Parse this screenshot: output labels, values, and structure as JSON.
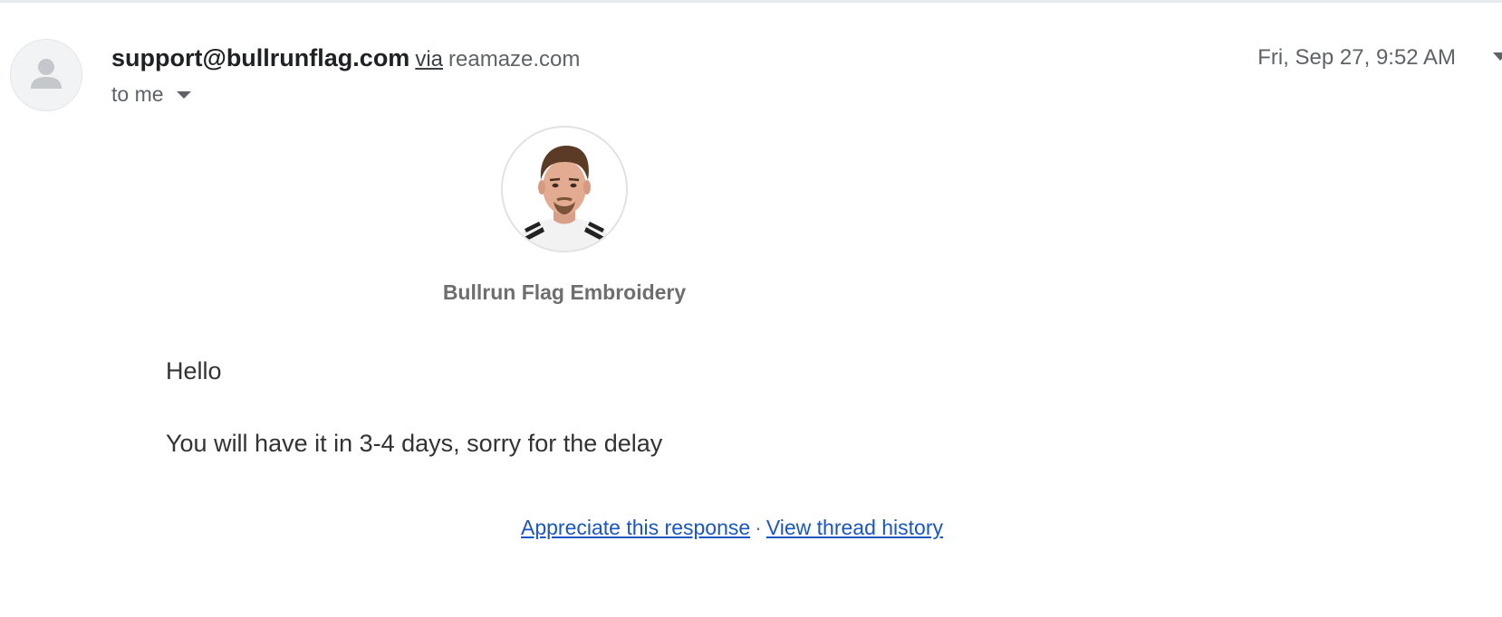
{
  "header": {
    "sender_email": "support@bullrunflag.com",
    "via_label": "via",
    "via_domain": "reamaze.com",
    "recipient_label": "to me",
    "date": "Fri, Sep 27, 9:52 AM"
  },
  "icons": {
    "sender_avatar": "person-silhouette-icon",
    "recipient_details": "chevron-down-icon",
    "more_options": "chevron-down-icon"
  },
  "body": {
    "agent_name": "Bullrun Flag Embroidery",
    "greeting": "Hello",
    "message": "You will have it in 3-4 days, sorry for the delay"
  },
  "footer_links": {
    "appreciate": "Appreciate this response",
    "separator": "·",
    "history": "View thread history"
  },
  "colors": {
    "link": "#1a56c4",
    "text": "#333333",
    "muted": "#5f6368"
  }
}
